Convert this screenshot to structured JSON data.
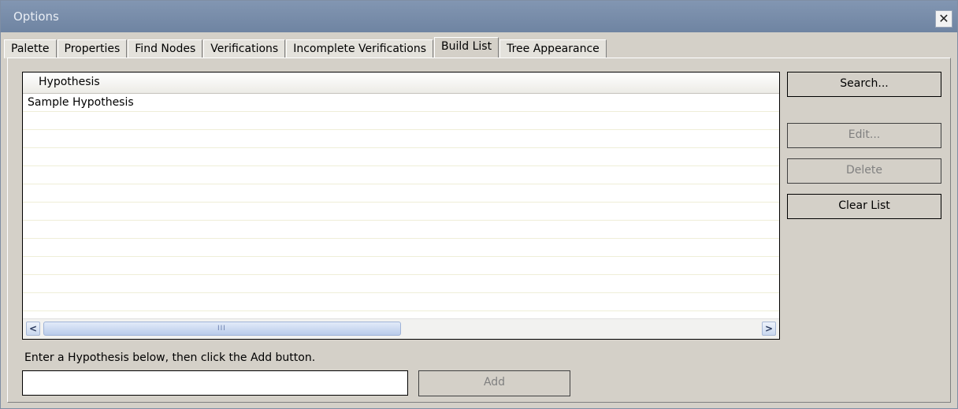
{
  "window": {
    "title": "Options",
    "close_glyph": "✕"
  },
  "tabs": [
    {
      "label": "Palette"
    },
    {
      "label": "Properties"
    },
    {
      "label": "Find Nodes"
    },
    {
      "label": "Verifications"
    },
    {
      "label": "Incomplete Verifications"
    },
    {
      "label": "Build List",
      "active": true
    },
    {
      "label": "Tree Appearance"
    }
  ],
  "list": {
    "column_header": "Hypothesis",
    "rows": [
      "Sample Hypothesis"
    ],
    "scroll_left_glyph": "<",
    "scroll_right_glyph": ">",
    "scroll_grip": "III"
  },
  "buttons": {
    "search": "Search...",
    "edit": "Edit...",
    "delete": "Delete",
    "clear_list": "Clear List",
    "add": "Add"
  },
  "entry": {
    "hint": "Enter a Hypothesis below, then click the Add button.",
    "value": ""
  }
}
